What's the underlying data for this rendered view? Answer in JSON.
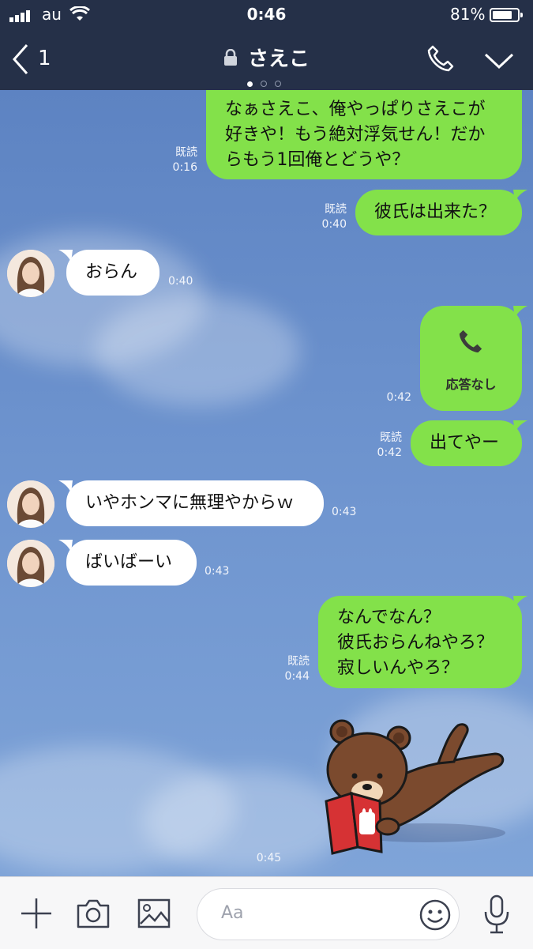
{
  "status_bar": {
    "carrier": "au",
    "time": "0:46",
    "battery": "81%",
    "battery_level": 0.81
  },
  "header": {
    "back_count": "1",
    "title": "さえこ",
    "page_dots": 3,
    "active_dot": 0,
    "icons": [
      "back-chevron-icon",
      "lock-icon",
      "phone-icon",
      "chevron-down-icon"
    ],
    "background": "#253048"
  },
  "messages": [
    {
      "side": "out",
      "lines": [
        "なぁさえこ、俺やっぱりさえこが",
        "好きや！もう絶対浮気せん！だか",
        "らもう1回俺とどうや？"
      ],
      "read": "既読",
      "time": "0:16"
    },
    {
      "side": "out",
      "lines": [
        "彼氏は出来た？"
      ],
      "read": "既読",
      "time": "0:40"
    },
    {
      "side": "in",
      "lines": [
        "おらん"
      ],
      "time": "0:40"
    },
    {
      "side": "out",
      "type": "call",
      "label": "応答なし",
      "icon": "phone-icon",
      "time": "0:42"
    },
    {
      "side": "out",
      "lines": [
        "出てやー"
      ],
      "read": "既読",
      "time": "0:42"
    },
    {
      "side": "in",
      "lines": [
        "いやホンマに無理やからｗ"
      ],
      "time": "0:43"
    },
    {
      "side": "in",
      "lines": [
        "ばいばーい"
      ],
      "time": "0:43"
    },
    {
      "side": "out",
      "lines": [
        "なんでなん？",
        "彼氏おらんねやろ？",
        "寂しいんやろ？"
      ],
      "read": "既読",
      "time": "0:44"
    },
    {
      "side": "out",
      "type": "sticker",
      "sticker": "brown-bear-reading-sticker",
      "time": "0:45"
    }
  ],
  "input_bar": {
    "placeholder": "Aa",
    "icons": [
      "plus-icon",
      "camera-icon",
      "image-icon",
      "emoji-icon",
      "microphone-icon"
    ]
  },
  "colors": {
    "outgoing_bubble": "#83e14a",
    "incoming_bubble": "#ffffff",
    "chat_background": "#6a8fcb",
    "header": "#253048"
  }
}
